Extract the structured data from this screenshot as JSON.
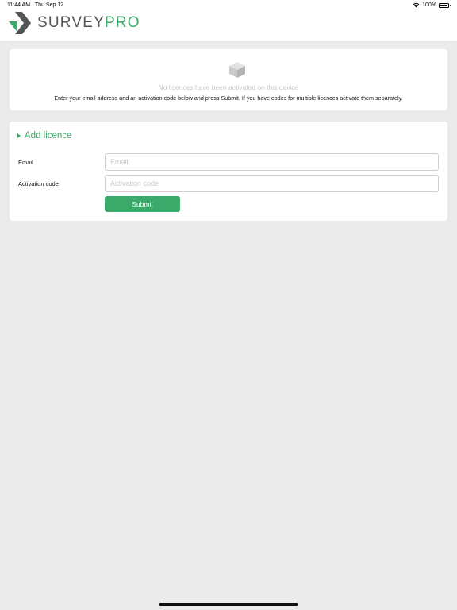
{
  "status_bar": {
    "time": "11:44 AM",
    "date": "Thu Sep 12",
    "battery": "100%"
  },
  "header": {
    "logo_survey": "SURVEY",
    "logo_pro": "PRO"
  },
  "info_card": {
    "icon": "cube-icon",
    "empty_message": "No licences have been activated on this device",
    "instructions": "Enter your email address and an activation code below and press Submit. If you have codes for multiple licences activate them separately."
  },
  "form_card": {
    "section_title": "Add licence",
    "email_label": "Email",
    "email_placeholder": "Email",
    "email_value": "",
    "code_label": "Activation code",
    "code_placeholder": "Activation code",
    "code_value": "",
    "submit_label": "Submit"
  },
  "colors": {
    "accent": "#3aa96a",
    "background": "#ebebeb",
    "card": "#ffffff"
  }
}
